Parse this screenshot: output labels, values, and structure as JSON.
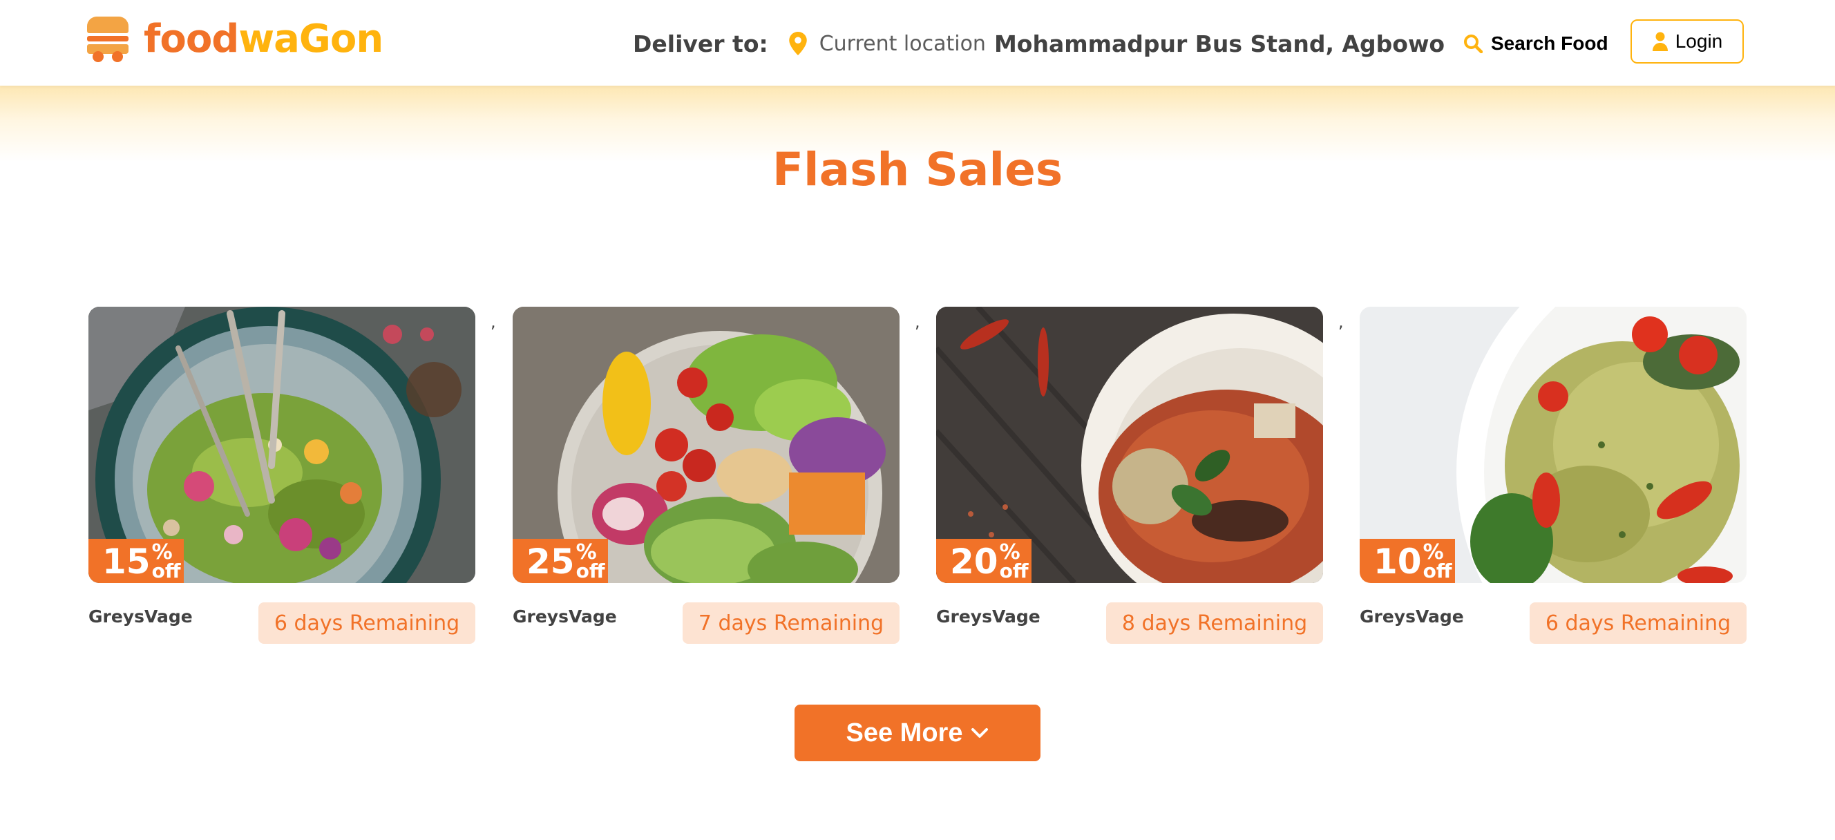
{
  "header": {
    "logo": {
      "part1": "food",
      "part2": "waGon",
      "icon": "burger-truck-icon"
    },
    "deliver_label": "Deliver to:",
    "location_icon": "location-pin-icon",
    "current_location": "Current location",
    "address": "Mohammadpur Bus Stand, Agbowo",
    "search_icon": "search-icon",
    "search_label": "Search Food",
    "login_icon": "user-icon",
    "login_label": "Login"
  },
  "section_title": "Flash Sales",
  "separator": ",",
  "cards": [
    {
      "discount": "15",
      "percent": "%",
      "off": "off",
      "vendor": "GreysVage",
      "remaining": "6 days Remaining",
      "image": "green bowl salad with flowers"
    },
    {
      "discount": "25",
      "percent": "%",
      "off": "off",
      "vendor": "GreysVage",
      "remaining": "7 days Remaining",
      "image": "buddha bowl with tomatoes avocado chickpeas"
    },
    {
      "discount": "20",
      "percent": "%",
      "off": "off",
      "vendor": "GreysVage",
      "remaining": "8 days Remaining",
      "image": "thai red curry bowl"
    },
    {
      "discount": "10",
      "percent": "%",
      "off": "off",
      "vendor": "GreysVage",
      "remaining": "6 days Remaining",
      "image": "pesto bow-tie pasta salad"
    }
  ],
  "see_more_label": "See More",
  "see_more_icon": "chevron-down-icon",
  "colors": {
    "primary": "#f17228",
    "accent": "#ffb30e",
    "badge_bg": "#fde3d2",
    "text_dark": "#424242"
  }
}
